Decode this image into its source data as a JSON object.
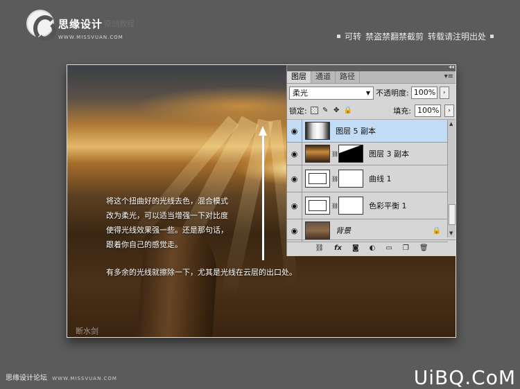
{
  "site": {
    "logo_name": "思缘设计",
    "logo_sub": "原创教程",
    "logo_url": "WWW.MISSVUAN.COM"
  },
  "header_right": {
    "item1": "可转",
    "item2": "禁盗禁翻禁截剪",
    "item3": "转载请注明出处"
  },
  "caption": {
    "line1": "将这个扭曲好的光线去色，混合模式",
    "line2": "改为柔光，可以适当增强一下对比度",
    "line3": "使得光线效果强一些。还是那句话，",
    "line4": "跟着你自己的感觉走。",
    "line5": "有多余的光线就擦除一下，尤其是光线在云层的出口处。"
  },
  "image_watermark": "断水剑",
  "panel": {
    "tabs": [
      "图层",
      "通道",
      "路径"
    ],
    "blend_mode": "柔光",
    "opacity_label": "不透明度:",
    "opacity_value": "100%",
    "lock_label": "锁定:",
    "fill_label": "填充:",
    "fill_value": "100%",
    "layers": [
      {
        "name": "图层 5 副本",
        "selected": true
      },
      {
        "name": "图层 3 副本",
        "selected": false
      },
      {
        "name": "曲线 1",
        "selected": false
      },
      {
        "name": "色彩平衡 1",
        "selected": false
      },
      {
        "name": "背景",
        "selected": false
      }
    ],
    "footer_icons": [
      "link-icon",
      "fx-icon",
      "mask-icon",
      "adjustment-icon",
      "folder-icon",
      "new-layer-icon",
      "trash-icon"
    ],
    "footer_fx": "fx"
  },
  "footer": {
    "left_text": "思缘设计论坛",
    "left_url": "WWW.MISSVUAN.COM",
    "right_brand": "UiBQ.CoM"
  }
}
